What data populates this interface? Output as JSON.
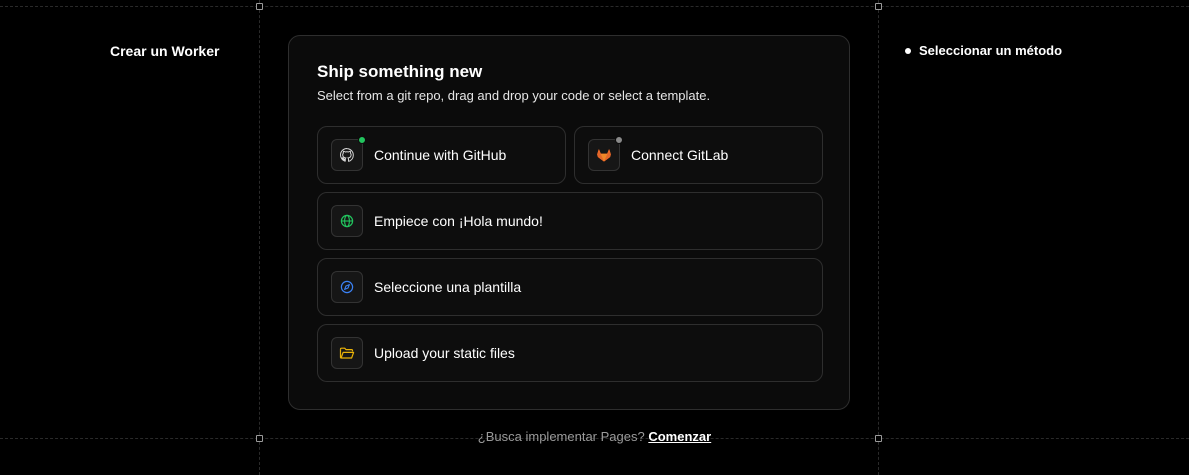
{
  "left_panel": {
    "title": "Crear un Worker"
  },
  "steps": {
    "current": "Seleccionar un método"
  },
  "card": {
    "title": "Ship something new",
    "subtitle": "Select from a git repo, drag and drop your code or select a template."
  },
  "options": {
    "github": {
      "label": "Continue with GitHub",
      "icon": "github-icon",
      "status": "connected",
      "status_color": "#22c55e"
    },
    "gitlab": {
      "label": "Connect GitLab",
      "icon": "gitlab-icon",
      "status": "disconnected",
      "status_color": "#8a8a8a"
    },
    "hello_world": {
      "label": "Empiece con ¡Hola mundo!",
      "icon": "globe-icon"
    },
    "template": {
      "label": "Seleccione una plantilla",
      "icon": "compass-icon"
    },
    "upload": {
      "label": "Upload your static files",
      "icon": "folder-icon"
    }
  },
  "footer": {
    "question": "¿Busca implementar Pages?",
    "link": "Comenzar"
  },
  "colors": {
    "background": "#000000",
    "card": "#0b0b0b",
    "border": "#2e2e2e",
    "github_dot": "#22c55e",
    "gitlab_orange": "#e2662b",
    "globe_green": "#22c55e",
    "compass_blue": "#3b82f6",
    "folder_yellow": "#eab308"
  }
}
